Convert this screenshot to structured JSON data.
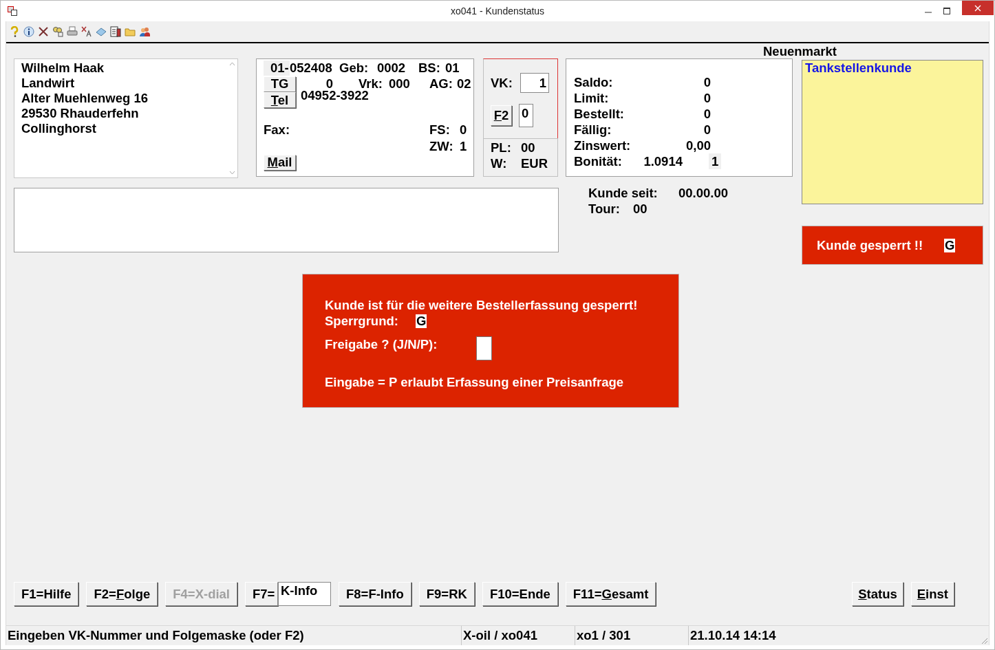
{
  "window": {
    "title": "xo041 - Kundenstatus"
  },
  "branch": "Neuenmarkt",
  "address": {
    "lines": [
      "Wilhelm Haak",
      "Landwirt",
      "Alter Muehlenweg 16",
      "29530 Rhauderfehn",
      "Collinghorst"
    ]
  },
  "contact": {
    "account_prefix": "01-",
    "account": "052408",
    "geb_label": "Geb:",
    "geb": "0002",
    "bs_label": "BS:",
    "bs": "01",
    "tg_button": {
      "pre": "TG"
    },
    "tg_value": "0",
    "vrk_label": "Vrk:",
    "vrk": "000",
    "ag_label": "AG:",
    "ag": "02",
    "tel_button": {
      "key": "T",
      "post": "el"
    },
    "phone": "04952-3922",
    "fax_label": "Fax:",
    "fs_label": "FS:",
    "fs": "0",
    "zw_label": "ZW:",
    "zw": "1",
    "mail_button": {
      "key": "M",
      "post": "ail"
    }
  },
  "vk": {
    "label": "VK:",
    "value": "1",
    "f2_button": {
      "key": "F",
      "post": "2"
    },
    "f2_value": "0",
    "pl_label": "PL:",
    "pl": "00",
    "w_label": "W:",
    "w": "EUR"
  },
  "balances": [
    {
      "kind": "amount",
      "label": "Saldo:",
      "value": "0"
    },
    {
      "kind": "amount",
      "label": "Limit:",
      "value": "0"
    },
    {
      "kind": "amount",
      "label": "Bestellt:",
      "value": "0"
    },
    {
      "kind": "amount",
      "label": "Fällig:",
      "value": "0"
    },
    {
      "kind": "amount",
      "label": "Zinswert:",
      "value": "0,00"
    },
    {
      "kind": "rating",
      "label": "Bonität:",
      "value": "1.0914",
      "extra": "1"
    }
  ],
  "since": {
    "label": "Kunde seit:",
    "value": "00.00.00"
  },
  "tour": {
    "label": "Tour:",
    "value": "00"
  },
  "note": "Tankstellenkunde",
  "lock_banner": {
    "text": "Kunde gesperrt !!",
    "code": "G"
  },
  "dialog": {
    "message": "Kunde ist für die weitere Bestellerfassung gesperrt!",
    "reason_label": "Sperrgrund:",
    "reason_code": "G",
    "release_label": "Freigabe ? (J/N/P):",
    "hint": "Eingabe = P erlaubt Erfassung einer Preisanfrage"
  },
  "function_keys": [
    {
      "kind": "button",
      "pre": "F1=Hilfe",
      "disabled": false
    },
    {
      "kind": "button",
      "pre": "F2=",
      "key": "F",
      "post": "olge",
      "disabled": false
    },
    {
      "kind": "button",
      "pre": "F4=X-dial",
      "disabled": true
    },
    {
      "kind": "field",
      "pre": "F7=",
      "value": "K-Info",
      "disabled": false
    },
    {
      "kind": "button",
      "pre": "F8=F-Info",
      "disabled": false
    },
    {
      "kind": "button",
      "pre": "F9=RK",
      "disabled": false
    },
    {
      "kind": "button",
      "pre": "F10=Ende",
      "disabled": false
    },
    {
      "kind": "button",
      "pre": "F11=",
      "key": "G",
      "post": "esamt",
      "disabled": false
    }
  ],
  "side_buttons": [
    {
      "key": "S",
      "post": "tatus"
    },
    {
      "key": "E",
      "post": "inst"
    }
  ],
  "status_bar": [
    "Eingeben VK-Nummer und Folgemaske (oder F2)",
    "X-oil / xo041",
    "xo1 / 301",
    "21.10.14 14:14"
  ]
}
